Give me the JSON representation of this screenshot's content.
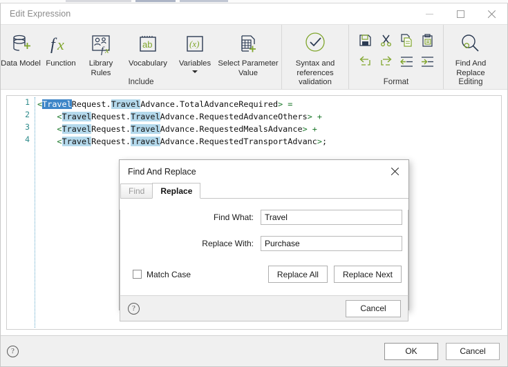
{
  "window": {
    "title": "Edit Expression",
    "controls": {
      "minimize": "minimize-icon",
      "maximize": "maximize-icon",
      "close": "close-icon"
    }
  },
  "ribbon": {
    "include_group": {
      "label": "Include",
      "items": [
        {
          "label": "Data Model",
          "icon": "database-add-icon"
        },
        {
          "label": "Function",
          "icon": "fx-icon"
        },
        {
          "label": "Library Rules",
          "icon": "people-fx-icon"
        },
        {
          "label": "Vocabulary",
          "icon": "notepad-ab-icon"
        },
        {
          "label": "Variables",
          "icon": "variable-x-icon",
          "has_dropdown": true
        },
        {
          "label": "Select Parameter Value",
          "icon": "table-add-icon"
        }
      ]
    },
    "validation_group": {
      "items": [
        {
          "label": "Syntax and references validation",
          "icon": "check-circle-icon"
        }
      ]
    },
    "format_group": {
      "label": "Format",
      "icons": [
        "save-icon",
        "cut-scissors-icon",
        "copy-icon",
        "paste-icon",
        "undo-icon",
        "redo-icon",
        "outdent-icon",
        "indent-icon"
      ]
    },
    "editing_group": {
      "label": "Editing",
      "items": [
        {
          "label": "Find And Replace",
          "icon": "find-replace-magnifier-icon"
        }
      ]
    }
  },
  "editor": {
    "gutter": [
      "1",
      "2",
      "3",
      "4"
    ],
    "lines": [
      {
        "indent": "",
        "segments": [
          {
            "text": "<",
            "style": "ang"
          },
          {
            "text": "Travel",
            "style": "sel"
          },
          {
            "text": "Request.",
            "style": "plain"
          },
          {
            "text": "Travel",
            "style": "hl"
          },
          {
            "text": "Advance.TotalAdvanceRequired",
            "style": "plain"
          },
          {
            "text": ">",
            "style": "ang"
          },
          {
            "text": " = ",
            "style": "op"
          }
        ]
      },
      {
        "indent": "    ",
        "segments": [
          {
            "text": "<",
            "style": "ang"
          },
          {
            "text": "Travel",
            "style": "hl"
          },
          {
            "text": "Request.",
            "style": "plain"
          },
          {
            "text": "Travel",
            "style": "hl"
          },
          {
            "text": "Advance.RequestedAdvanceOthers",
            "style": "plain"
          },
          {
            "text": ">",
            "style": "ang"
          },
          {
            "text": " + ",
            "style": "op"
          }
        ]
      },
      {
        "indent": "    ",
        "segments": [
          {
            "text": "<",
            "style": "ang"
          },
          {
            "text": "Travel",
            "style": "hl"
          },
          {
            "text": "Request.",
            "style": "plain"
          },
          {
            "text": "Travel",
            "style": "hl"
          },
          {
            "text": "Advance.RequestedMealsAdvance",
            "style": "plain"
          },
          {
            "text": ">",
            "style": "ang"
          },
          {
            "text": " + ",
            "style": "op"
          }
        ]
      },
      {
        "indent": "    ",
        "segments": [
          {
            "text": "<",
            "style": "ang"
          },
          {
            "text": "Travel",
            "style": "hl"
          },
          {
            "text": "Request.",
            "style": "plain"
          },
          {
            "text": "Travel",
            "style": "hl"
          },
          {
            "text": "Advance.RequestedTransportAdvanc",
            "style": "plain"
          },
          {
            "text": ">",
            "style": "ang"
          },
          {
            "text": ";",
            "style": "plain"
          }
        ]
      }
    ]
  },
  "footer": {
    "help": "?",
    "ok_label": "OK",
    "cancel_label": "Cancel"
  },
  "dialog": {
    "title": "Find And Replace",
    "close_icon": "close-icon",
    "tabs": [
      {
        "label": "Find",
        "active": false
      },
      {
        "label": "Replace",
        "active": true
      }
    ],
    "fields": [
      {
        "label": "Find What:",
        "value": "Travel",
        "placeholder": ""
      },
      {
        "label": "Replace With:",
        "value": "Purchase",
        "placeholder": ""
      }
    ],
    "match_case": {
      "label": "Match Case",
      "checked": false
    },
    "replace_all_label": "Replace All",
    "replace_next_label": "Replace Next",
    "help": "?",
    "cancel_label": "Cancel"
  },
  "colors": {
    "accent_green": "#7fa52b",
    "icon_navy": "#2b3a52",
    "selection_blue": "#3e86c8",
    "highlight_blue": "#b4d9ec",
    "line_number": "#2e8b8b",
    "code_green": "#1f7a2e"
  }
}
